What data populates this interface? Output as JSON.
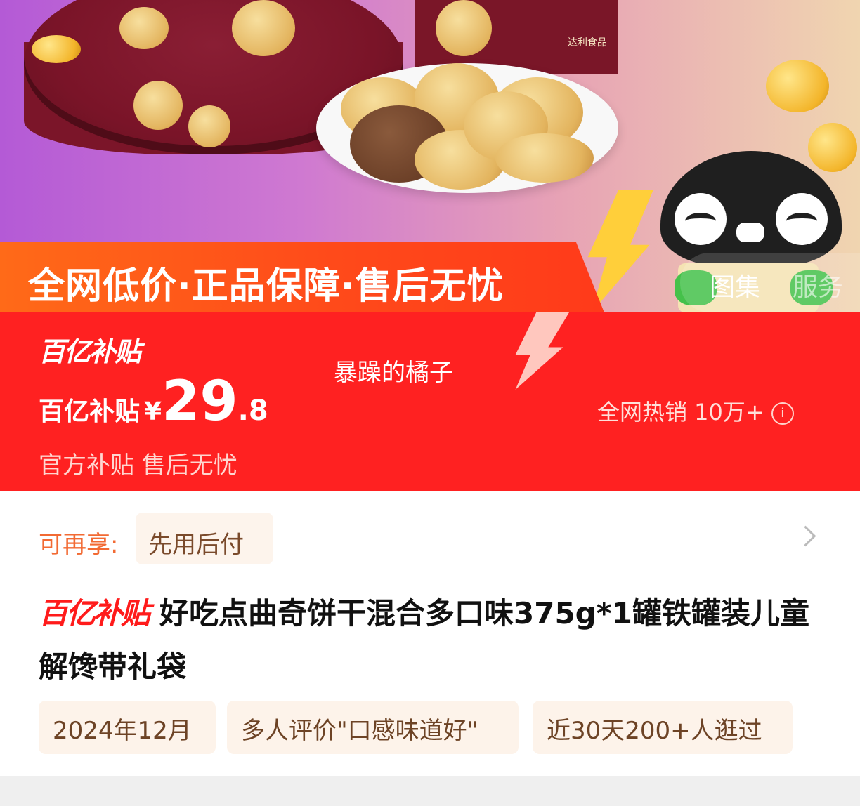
{
  "hero": {
    "slogan": "全网低价·正品保障·售后无忧",
    "box_brand": "达利食品",
    "media_tabs": [
      "图集",
      "服务"
    ]
  },
  "banner": {
    "logo": "百亿补贴",
    "handle": "暴躁的橘子",
    "price_label": "百亿补贴",
    "currency": "¥",
    "price_int": "29",
    "price_dec": ".8",
    "sales": "全网热销 10万+",
    "info_icon": "ⓘ",
    "official": "官方补贴 售后无忧"
  },
  "card": {
    "enjoy_label": "可再享:",
    "pay_option": "先用后付",
    "title_logo": "百亿补贴",
    "title": "好吃点曲奇饼干混合多口味375g*1罐铁罐装儿童解馋带礼袋",
    "tags": [
      "2024年12月",
      "多人评价\"口感味道好\"",
      "近30天200+人逛过"
    ]
  },
  "colors": {
    "banner_red": "#ff2121",
    "slogan_orange": "#ff5a18",
    "accent_orange": "#f26a33",
    "tag_bg": "#fdf3ea"
  }
}
